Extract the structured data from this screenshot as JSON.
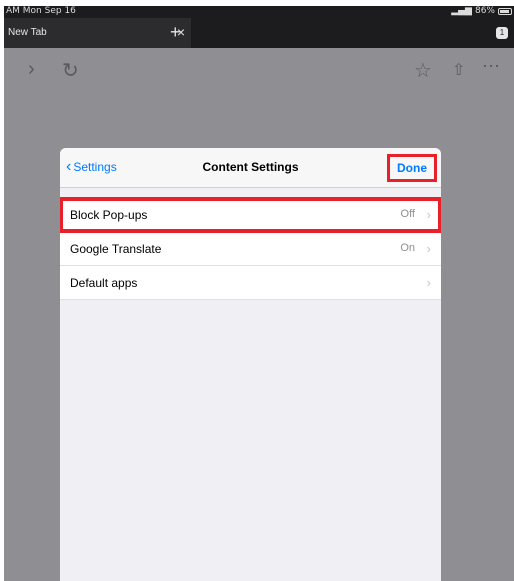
{
  "status_bar": {
    "time": "AM  Mon Sep 16",
    "battery": "86%"
  },
  "browser": {
    "tab_title": "New Tab",
    "tab_close": "×",
    "new_tab": "+",
    "tab_count": "1",
    "icons": {
      "forward": "forward-icon",
      "reload": "reload-icon",
      "bookmark": "star-icon",
      "share": "share-icon",
      "menu": "more-icon"
    }
  },
  "settings": {
    "back_label": "Settings",
    "title": "Content Settings",
    "done_label": "Done",
    "rows": [
      {
        "label": "Block Pop-ups",
        "value": "Off",
        "highlighted": true
      },
      {
        "label": "Google Translate",
        "value": "On",
        "highlighted": false
      },
      {
        "label": "Default apps",
        "value": "",
        "highlighted": false
      }
    ]
  },
  "colors": {
    "accent": "#007aff",
    "highlight": "#e8202a",
    "background": "#8e8e93"
  }
}
